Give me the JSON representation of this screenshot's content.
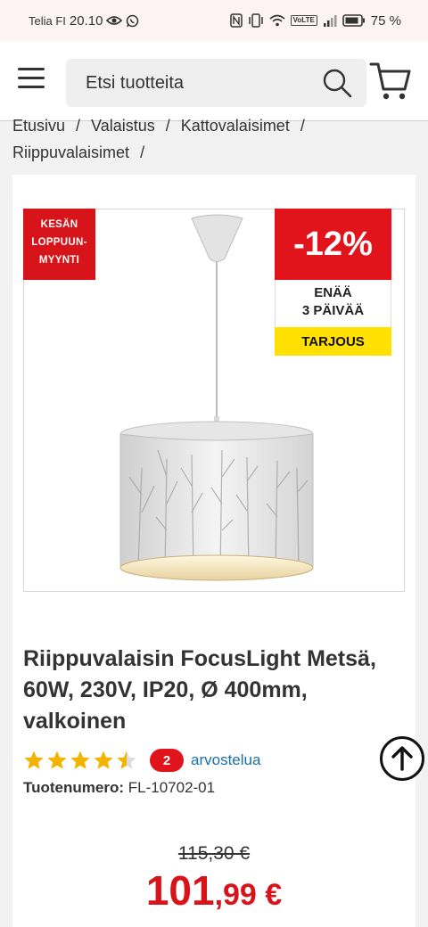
{
  "status_bar": {
    "carrier": "Telia FI",
    "time": "20.10",
    "volte": "VoLTE",
    "battery": "75 %"
  },
  "search": {
    "placeholder": "Etsi tuotteita"
  },
  "breadcrumb": [
    {
      "label": "Etusivu"
    },
    {
      "label": "Valaistus"
    },
    {
      "label": "Kattovalaisimet"
    },
    {
      "label": "Riippuvalaisimet"
    }
  ],
  "breadcrumb_sep": "/",
  "badges": {
    "season": [
      "KESÄN",
      "LOPPUUN-",
      "MYYNTI"
    ],
    "discount": "-12%",
    "days_left_line1": "ENÄÄ",
    "days_left_line2": "3 PÄIVÄÄ",
    "offer": "TARJOUS"
  },
  "product": {
    "title": "Riippuvalaisin FocusLight Metsä, 60W, 230V, IP20, Ø 400mm, valkoinen",
    "rating": 4.5,
    "review_count": "2",
    "review_label": "arvostelua",
    "product_number_label": "Tuotenumero:",
    "product_number": "FL-10702-01",
    "old_price": "115,30 €",
    "price_main": "101",
    "price_cents": ",99 €"
  },
  "colors": {
    "brand_red": "#e1141b",
    "offer_yellow": "#ffe000",
    "star": "#f5b301",
    "link": "#1a6fa8"
  }
}
